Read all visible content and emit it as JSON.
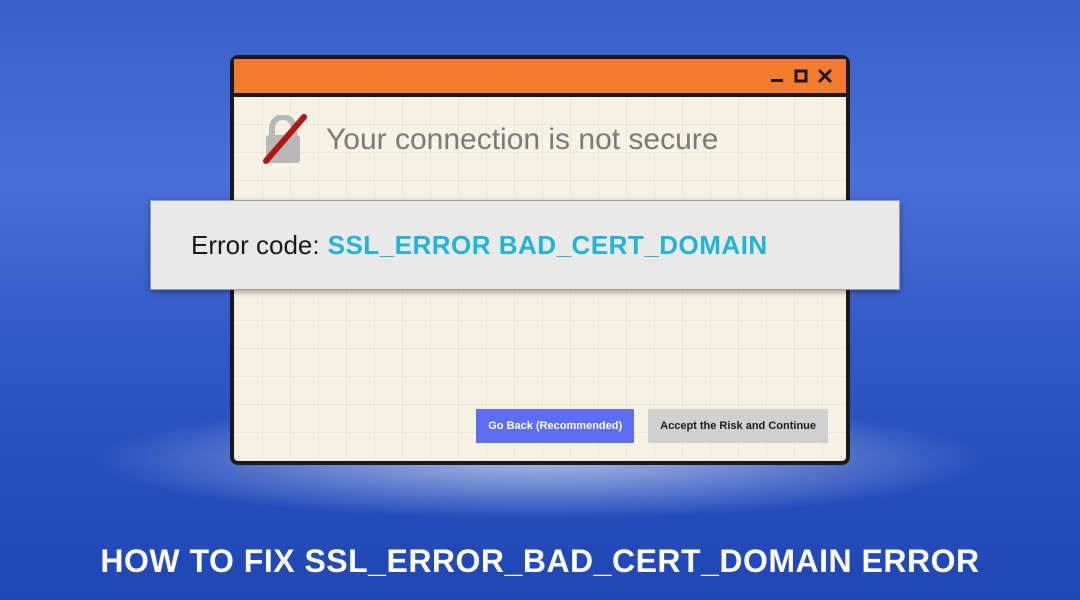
{
  "window": {
    "headline": "Your connection is not secure"
  },
  "error": {
    "label": "Error code:",
    "code": "SSL_ERROR BAD_CERT_DOMAIN"
  },
  "buttons": {
    "primary": "Go Back (Recommended)",
    "secondary": "Accept the Risk and Continue"
  },
  "caption": "HOW TO FIX SSL_ERROR_BAD_CERT_DOMAIN ERROR",
  "colors": {
    "accent": "#f47c2c",
    "primary_button": "#5b6ef5",
    "code": "#1fb5d6"
  }
}
